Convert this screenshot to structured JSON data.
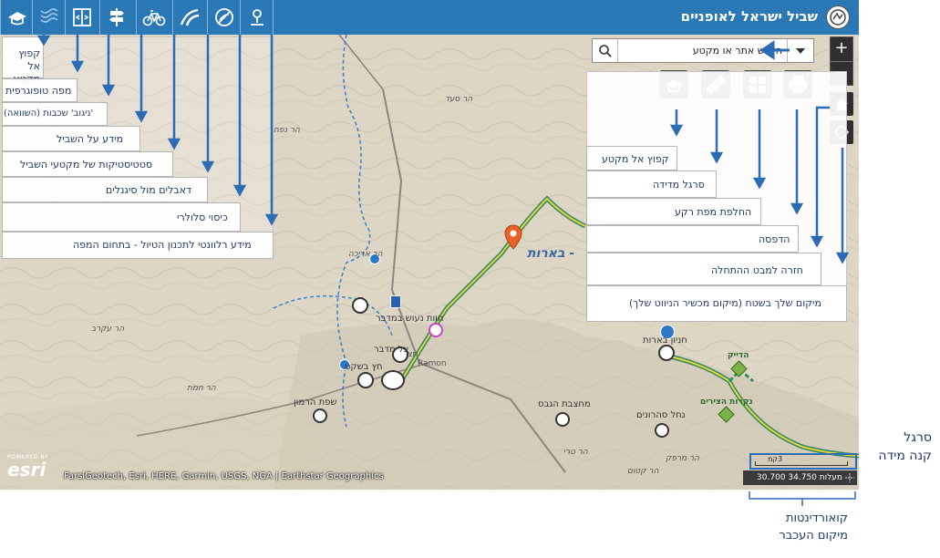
{
  "header": {
    "title": "שביל ישראל לאופניים",
    "logo_icon": "israel-trail-logo-icon",
    "color": "#2b78b7"
  },
  "toolbar": {
    "tools": [
      {
        "icon": "hat-icon"
      },
      {
        "icon": "topo-map-icon"
      },
      {
        "icon": "layers-panel-icon"
      },
      {
        "icon": "signpost-icon"
      },
      {
        "icon": "bicycle-icon"
      },
      {
        "icon": "road-icon"
      },
      {
        "icon": "no-signal-icon"
      },
      {
        "icon": "location-pin-icon"
      }
    ]
  },
  "search": {
    "placeholder": "חיפוש אתר או מקטע"
  },
  "map_buttons": [
    {
      "icon": "hat-icon"
    },
    {
      "icon": "ruler-icon"
    },
    {
      "icon": "basemap-icon"
    },
    {
      "icon": "printer-icon"
    }
  ],
  "left_annotations": [
    "קפוץ אל\nמקטע...",
    "מפה טופוגרפית",
    "'ניגוב' שכבות (השוואה)",
    "מידע על השביל",
    "סטטיסטיקות של מקטעי השביל",
    "דאבלים מול סיגנלים",
    "כיסוי סלולרי",
    "מידע רלוונטי לתכנון הטיול  - בתחום המפה"
  ],
  "right_annotations": [
    "קפוץ אל מקטע",
    "סרגל מדידה",
    "החלפת מפת רקע",
    "הדפסה",
    "חזרה למבט ההתחלה",
    "מיקום שלך בשטח (מיקום מכשיר הניווט שלך)"
  ],
  "map_labels": {
    "tsin": "הר סעד",
    "nafha": "הר נפח",
    "arikha": "הר אריכה",
    "akrav": "הר עקרב",
    "hemet": "הר חמת",
    "ramon": "Ramon",
    "mitzpe": "מצ",
    "hatteva": "חוות נעוש במדבר",
    "tsel": "צל מדבר",
    "hetz": "חץ בשקט",
    "hermon": "שפת הרמון",
    "gavas": "מחצבת הגבס",
    "saharonim": "נחל סהרונים",
    "hadaik": "הדייק",
    "nekarot": "נקרות הצירים",
    "hanyon": "חניון בארות",
    "terey": "הר טרי",
    "marpek": "הר מרפק",
    "ktom": "הר קטום",
    "beerot": "- בארות"
  },
  "attribution": "FarsiGeotech, Esri, HERE, Garmin, USGS, NGA | Earthstar Geographics",
  "esri": {
    "powered": "POWERED BY",
    "name": "esri"
  },
  "scalebar": {
    "value": "3",
    "unit": "קמ"
  },
  "coords": {
    "text": "30.700 34.750 מעלות"
  },
  "side_annotations": {
    "scale": "סרגל\nקנה מידה",
    "coords": "קואורדינטות\nמיקום העכבר"
  },
  "colors": {
    "annotation_arrow": "#2b6cb5",
    "trail_yellow": "#e8d13c",
    "trail_green": "#2d8a6a"
  }
}
